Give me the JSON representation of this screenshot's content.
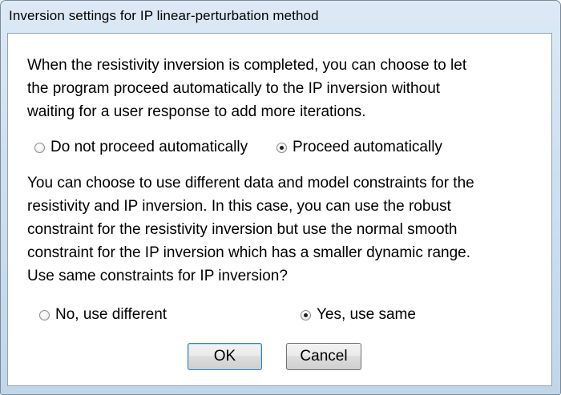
{
  "window": {
    "title": "Inversion settings for IP linear-perturbation method"
  },
  "section1": {
    "lines": [
      "When the resistivity inversion is completed, you can choose to let",
      "the program proceed automatically to the IP inversion without",
      "waiting for a user response to add more iterations."
    ],
    "options": [
      {
        "label": "Do not proceed automatically",
        "checked": false
      },
      {
        "label": "Proceed automatically",
        "checked": true
      }
    ]
  },
  "section2": {
    "lines": [
      "You can choose to use different data and model constraints for the",
      "resistivity and IP inversion. In this case, you can use the robust",
      "constraint for the resistivity inversion but use the normal smooth",
      "constraint for the IP inversion which has a smaller dynamic range.",
      "Use same constraints for IP inversion?"
    ],
    "options": [
      {
        "label": "No, use different",
        "checked": false
      },
      {
        "label": "Yes, use same",
        "checked": true
      }
    ]
  },
  "buttons": {
    "ok_label": "OK",
    "cancel_label": "Cancel"
  }
}
